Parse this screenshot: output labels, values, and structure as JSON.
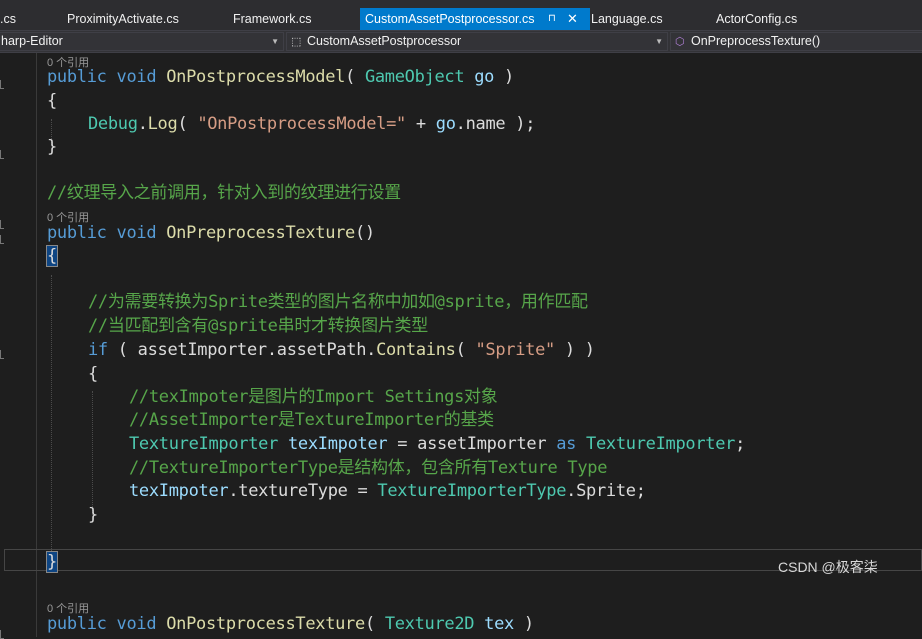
{
  "tabs": [
    {
      "label": ".cs"
    },
    {
      "label": "ProximityActivate.cs"
    },
    {
      "label": "Framework.cs"
    },
    {
      "label": "CustomAssetPostprocessor.cs"
    },
    {
      "label": "Language.cs"
    },
    {
      "label": "ActorConfig.cs"
    }
  ],
  "tab_pin_glyph": "⊓",
  "tab_close_glyph": "✕",
  "nav": {
    "project": "harp-Editor",
    "class_name": "CustomAssetPostprocessor",
    "member": "OnPreprocessTexture()"
  },
  "refs_label": "0 个引用",
  "code": {
    "l1_public": "public",
    "l1_void": "void",
    "l1_method": "OnPostprocessModel",
    "l1_open": "( ",
    "l1_type": "GameObject",
    "l1_param": "go",
    "l1_close": " )",
    "l2": "{",
    "l3_debug": "Debug",
    "l3_dot": ".",
    "l3_log": "Log",
    "l3_open": "( ",
    "l3_str": "\"OnPostprocessModel=\"",
    "l3_plus": " + ",
    "l3_go": "go",
    "l3_name": ".name",
    "l3_end": " );",
    "l4": "}",
    "c1": "//纹理导入之前调用，针对入到的纹理进行设置",
    "l5_public": "public",
    "l5_void": "void",
    "l5_method": "OnPreprocessTexture",
    "l5_paren": "()",
    "l6": "{",
    "c2": "//为需要转换为Sprite类型的图片名称中加如@sprite，用作匹配",
    "c3": "//当匹配到含有@sprite串时才转换图片类型",
    "l7_if": "if",
    "l7_a": " ( assetImporter.assetPath.",
    "l7_contains": "Contains",
    "l7_open": "( ",
    "l7_str": "\"Sprite\"",
    "l7_close": " ) )",
    "l8": "{",
    "c4": "//texImpoter是图片的Import Settings对象",
    "c5": "//AssetImporter是TextureImporter的基类",
    "l9_type": "TextureImporter",
    "l9_var": "texImpoter",
    "l9_eq": " = assetImporter ",
    "l9_as": "as",
    "l9_type2": "TextureImporter",
    "l9_end": ";",
    "c6": "//TextureImporterType是结构体，包含所有Texture Type",
    "l10_var": "texImpoter",
    "l10_a": ".textureType = ",
    "l10_type": "TextureImporterType",
    "l10_b": ".Sprite;",
    "l11": "}",
    "l12": "}",
    "l13_public": "public",
    "l13_void": "void",
    "l13_method": "OnPostprocessTexture",
    "l13_open": "( ",
    "l13_type": "Texture2D",
    "l13_param": "tex",
    "l13_close": " )"
  },
  "watermark": "CSDN @极客柒",
  "colors": {
    "keyword": "#569cd6",
    "type": "#4ec9b0",
    "method": "#dcdcaa",
    "string": "#d69d85",
    "comment": "#57a64a",
    "tab_active": "#007acc"
  }
}
